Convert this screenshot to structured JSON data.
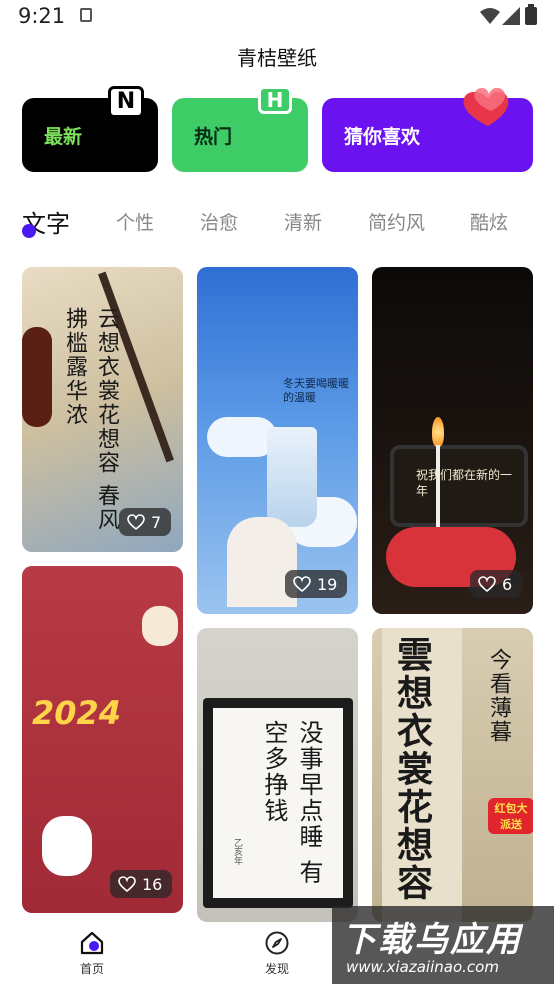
{
  "status_bar": {
    "time": "9:21"
  },
  "app_title": "青桔壁纸",
  "categories": [
    {
      "label": "最新",
      "badge": "N"
    },
    {
      "label": "热门",
      "badge": "H"
    },
    {
      "label": "猜你喜欢"
    }
  ],
  "tabs": [
    "文字",
    "个性",
    "治愈",
    "清新",
    "简约风",
    "酷炫"
  ],
  "active_tab": "文字",
  "wallpapers": [
    {
      "likes": "7",
      "text": "云想衣裳花想容 春风拂槛露华浓"
    },
    {
      "likes": "19",
      "text": "冬天要喝暖暖的温暖"
    },
    {
      "likes": "6",
      "text": "祝我们都在新的一年"
    },
    {
      "likes": "16",
      "text": "2024"
    },
    {
      "text": "没事早点睡 有空多挣钱",
      "seal": "乙亥年"
    },
    {
      "text": "雲想衣裳花想容",
      "side_text": "今看薄暮",
      "tag": "红包大派送"
    }
  ],
  "bottom_nav": [
    {
      "label": "首页",
      "icon": "home-icon"
    },
    {
      "label": "发现",
      "icon": "compass-icon"
    }
  ],
  "watermark": {
    "main": "下载乌应用",
    "sub": "www.xiazaiinao.com"
  },
  "colors": {
    "accent": "#6a12f0",
    "new_bg": "#000000",
    "hot_bg": "#3dcc66",
    "new_text": "#7ee05a"
  }
}
